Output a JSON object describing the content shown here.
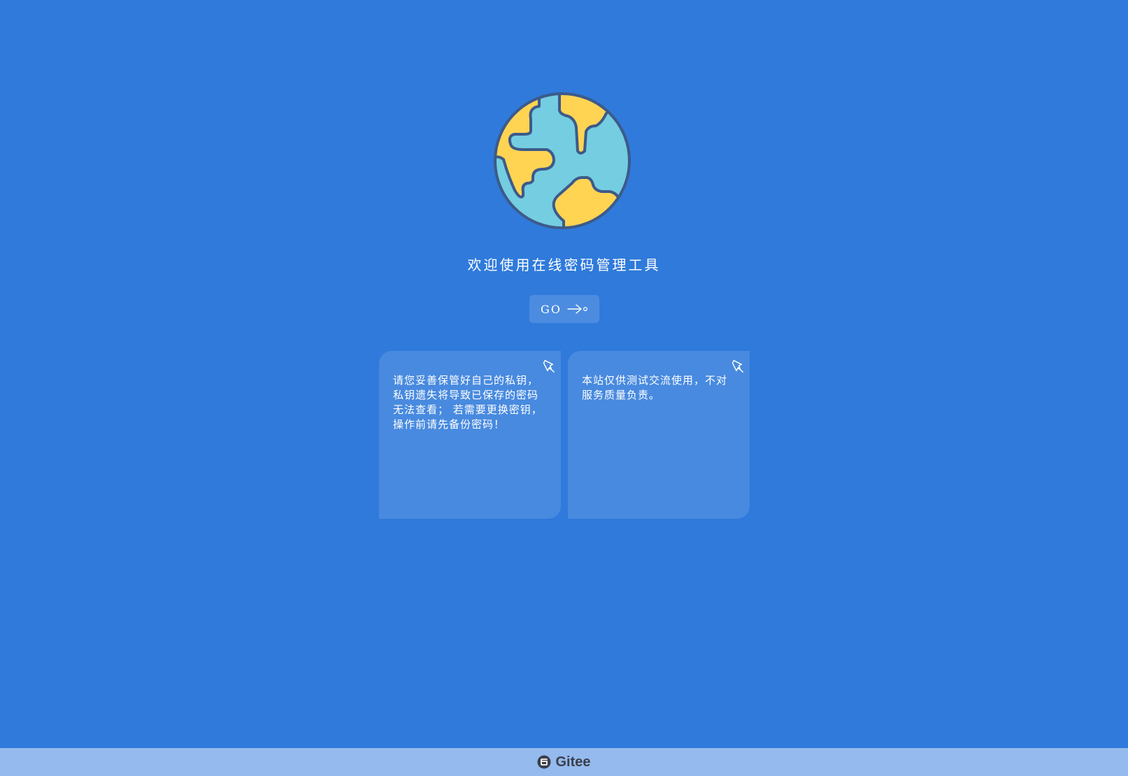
{
  "app": {
    "title": "欢迎使用在线密码管理工具",
    "go_label": "GO",
    "go_icon": "arrow-right-icon"
  },
  "hero": {
    "icon": "globe-icon"
  },
  "cards": [
    {
      "text": "请您妥善保管好自己的私钥，私钥遗失将导致已保存的密码无法查看； 若需要更换密钥，操作前请先备份密码！",
      "icon": "pin-icon"
    },
    {
      "text": "本站仅供测试交流使用，不对服务质量负责。",
      "icon": "pin-icon"
    }
  ],
  "footer": {
    "logo": "gitee-logo",
    "label": "Gitee"
  },
  "colors": {
    "background": "#2f7adb",
    "footer": "#94baee",
    "globe_ocean": "#74cde0",
    "globe_land": "#ffd452",
    "globe_outline": "#3d5a8a"
  }
}
